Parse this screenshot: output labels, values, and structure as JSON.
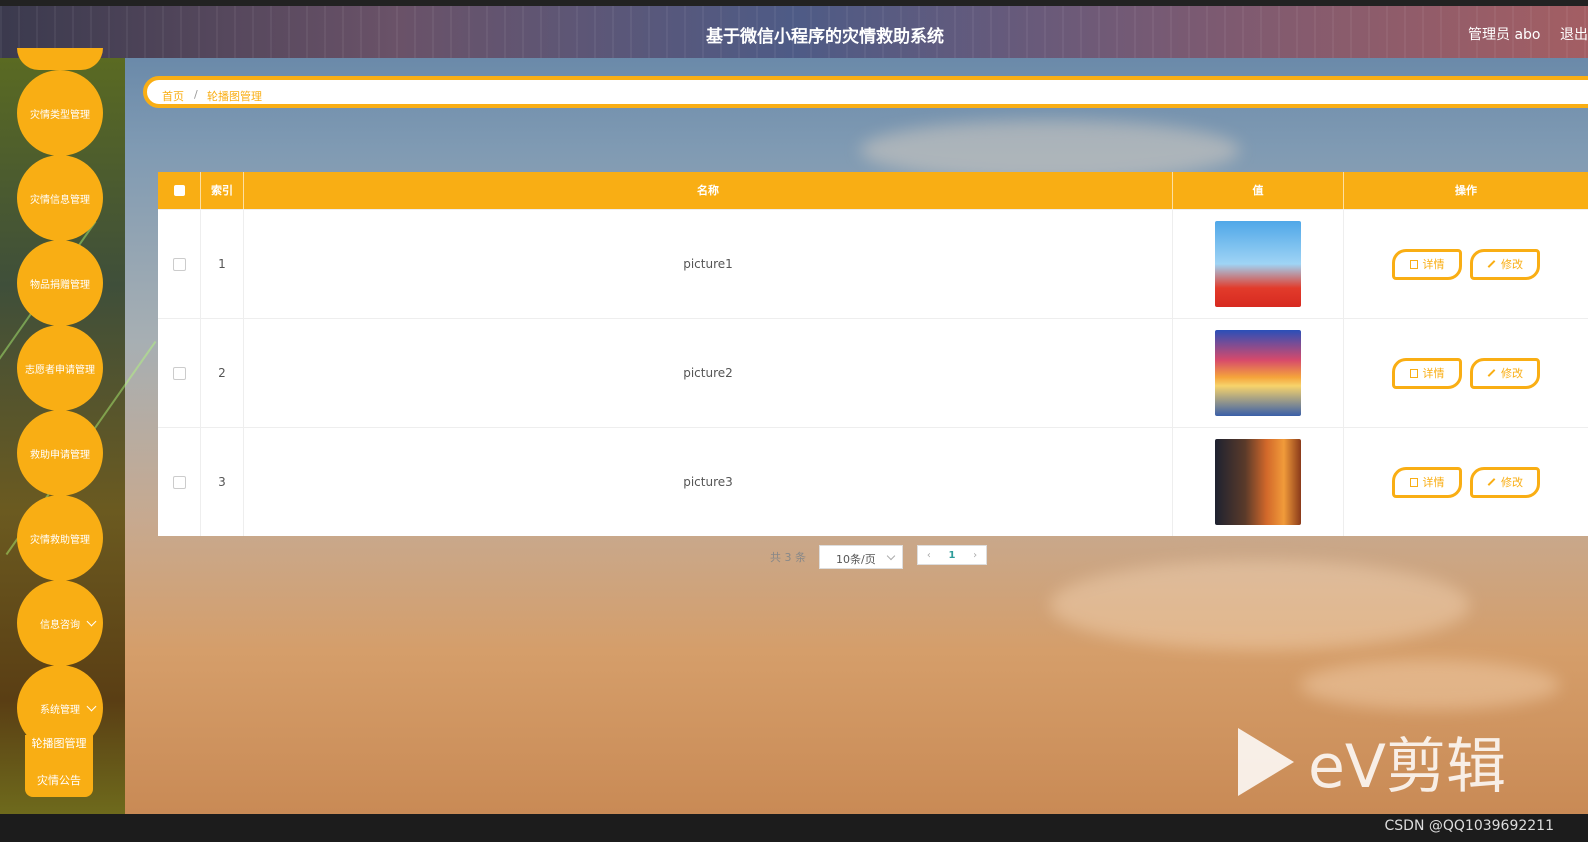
{
  "header": {
    "title": "基于微信小程序的灾情救助系统",
    "user": "管理员 abo",
    "logout": "退出"
  },
  "sidebar": {
    "items": [
      {
        "label": "灾情类型管理"
      },
      {
        "label": "灾情信息管理"
      },
      {
        "label": "物品捐赠管理"
      },
      {
        "label": "志愿者申请管理"
      },
      {
        "label": "救助申请管理"
      },
      {
        "label": "灾情救助管理"
      },
      {
        "label": "信息咨询"
      },
      {
        "label": "系统管理"
      }
    ],
    "submenu": [
      {
        "label": "轮播图管理"
      },
      {
        "label": "灾情公告"
      }
    ]
  },
  "breadcrumb": {
    "home": "首页",
    "sep": "/",
    "current": "轮播图管理"
  },
  "table": {
    "headers": {
      "index": "索引",
      "name": "名称",
      "value": "值",
      "actions": "操作"
    },
    "rows": [
      {
        "index": "1",
        "name": "picture1",
        "detail": "详情",
        "edit": "修改"
      },
      {
        "index": "2",
        "name": "picture2",
        "detail": "详情",
        "edit": "修改"
      },
      {
        "index": "3",
        "name": "picture3",
        "detail": "详情",
        "edit": "修改"
      }
    ]
  },
  "pagination": {
    "total": "共 3 条",
    "page_size": "10条/页",
    "prev": "‹",
    "current": "1",
    "next": "›"
  },
  "watermark": {
    "text": "eV剪辑"
  },
  "footer": {
    "credit": "CSDN @QQ1039692211"
  },
  "colors": {
    "accent": "#f9ae14",
    "page_num": "#2e9c9a"
  },
  "icons": [
    "chevron-down-icon",
    "document-icon",
    "edit-icon",
    "play-icon"
  ]
}
